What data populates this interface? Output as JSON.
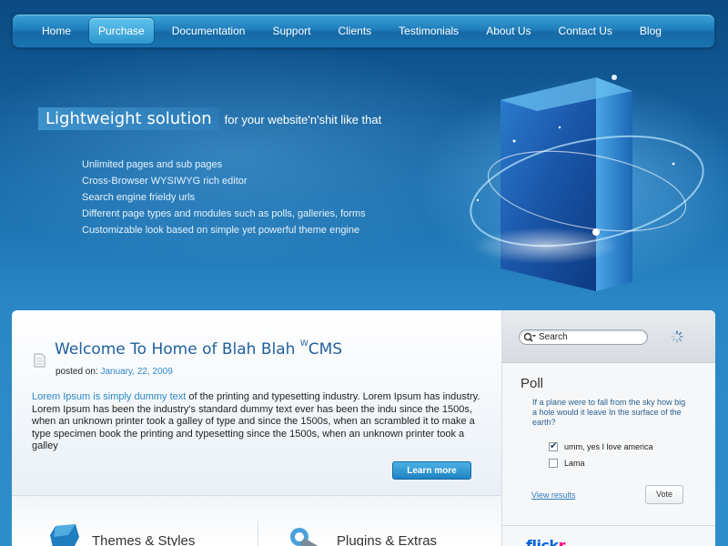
{
  "nav": {
    "items": [
      {
        "label": "Home"
      },
      {
        "label": "Purchase"
      },
      {
        "label": "Documentation"
      },
      {
        "label": "Support"
      },
      {
        "label": "Clients"
      },
      {
        "label": "Testimonials"
      },
      {
        "label": "About Us"
      },
      {
        "label": "Contact Us"
      },
      {
        "label": "Blog"
      }
    ],
    "active": "Purchase"
  },
  "hero": {
    "headline": "Lightweight solution",
    "subline": "for your  website'n'shit like that",
    "features": [
      "Unlimited pages and sub pages",
      "Cross-Browser WYSIWYG rich editor",
      "Search engine frieldy urls",
      "Different page types and modules such as  polls, galleries, forms",
      "Customizable look based on simple yet powerful theme engine"
    ]
  },
  "welcome": {
    "title_main": "Welcome To Home of Blah Blah ",
    "title_sup": "W",
    "title_end": "CMS",
    "posted_label": "posted on: ",
    "posted_date": "January, 22, 2009",
    "lead": "Lorem Ipsum is simply dummy text",
    "body": " of the printing and typesetting industry. Lorem Ipsum has industry. Lorem Ipsum has been the industry's standard dummy text ever  has been the indu since the 1500s, when an unknown printer took a galley of type and since the 1500s, when an scrambled it to make a type specimen book the printing and typesetting since the 1500s, when an unknown printer took a galley",
    "learn_more": "Learn more"
  },
  "features_strip": {
    "themes": "Themes & Styles",
    "plugins": "Plugins & Extras"
  },
  "sidebar": {
    "search_placeholder": "Search",
    "poll": {
      "title": "Poll",
      "question": "If a plane were to fall from the sky how big a hole would it leave In the surface of the earth?",
      "options": [
        {
          "label": "umm, yes I love america",
          "checked": true
        },
        {
          "label": "Lama",
          "checked": false
        }
      ],
      "view_results": "View results",
      "vote": "Vote"
    },
    "flickr": {
      "main": "flick",
      "accent": "r"
    }
  }
}
